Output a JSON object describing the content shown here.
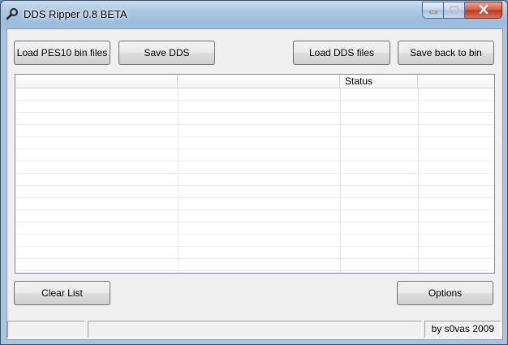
{
  "window": {
    "title": "DDS Ripper 0.8 BETA"
  },
  "caption_buttons": {
    "minimize_icon": "minimize-icon",
    "maximize_icon": "maximize-icon",
    "close_icon": "close-icon"
  },
  "toolbar": {
    "load_pes10_label": "Load PES10 bin files",
    "save_dds_label": "Save DDS",
    "load_dds_label": "Load DDS files",
    "save_back_label": "Save back to bin"
  },
  "list": {
    "columns": [
      "",
      "",
      "Status",
      ""
    ]
  },
  "bottom": {
    "clear_list_label": "Clear List",
    "options_label": "Options"
  },
  "statusbar": {
    "panels": [
      "",
      "",
      "by s0vas 2009"
    ]
  },
  "colors": {
    "title_glass": "#a9c6e2",
    "close_red": "#c0351d",
    "client_bg": "#f0f0f0"
  }
}
